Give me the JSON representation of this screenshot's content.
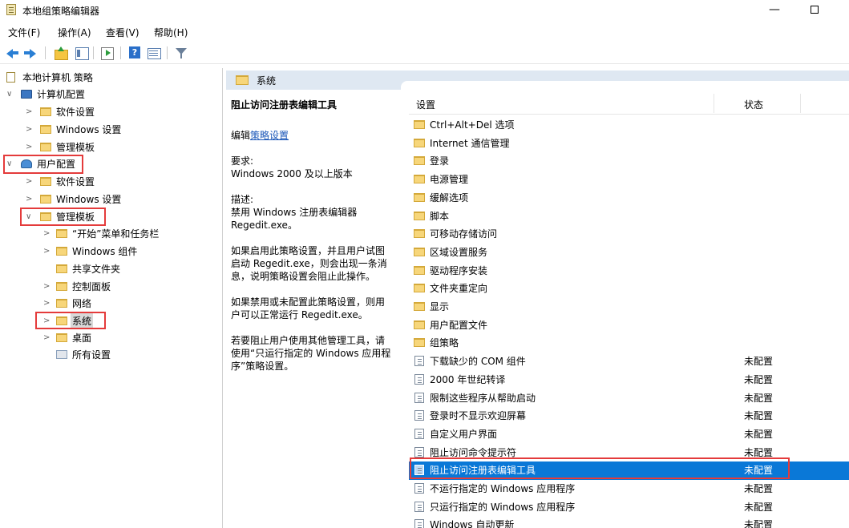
{
  "window": {
    "title": "本地组策略编辑器",
    "minimize_glyph": "—"
  },
  "menu": [
    {
      "label": "文件(F)"
    },
    {
      "label": "操作(A)"
    },
    {
      "label": "查看(V)"
    },
    {
      "label": "帮助(H)"
    }
  ],
  "toolbar": {
    "icons": [
      "back-arrow-icon",
      "forward-arrow-icon",
      "folder-up-icon",
      "show-hide-tree-icon",
      "export-list-icon",
      "help-icon",
      "details-view-icon",
      "filter-icon"
    ]
  },
  "tree": {
    "items": [
      {
        "label": "本地计算机 策略",
        "chevron": "",
        "icon": "policy-doc-icon"
      },
      {
        "label": "计算机配置",
        "chevron": "∨",
        "icon": "computer-icon"
      },
      {
        "label": "软件设置",
        "chevron": ">",
        "icon": "folder-icon"
      },
      {
        "label": "Windows 设置",
        "chevron": ">",
        "icon": "folder-icon"
      },
      {
        "label": "管理模板",
        "chevron": ">",
        "icon": "folder-icon"
      },
      {
        "label": "用户配置",
        "chevron": "∨",
        "icon": "users-icon"
      },
      {
        "label": "软件设置",
        "chevron": ">",
        "icon": "folder-icon"
      },
      {
        "label": "Windows 设置",
        "chevron": ">",
        "icon": "folder-icon"
      },
      {
        "label": "管理模板",
        "chevron": "∨",
        "icon": "folder-icon"
      },
      {
        "label": "“开始”菜单和任务栏",
        "chevron": ">",
        "icon": "folder-icon"
      },
      {
        "label": "Windows 组件",
        "chevron": ">",
        "icon": "folder-icon"
      },
      {
        "label": "共享文件夹",
        "chevron": "",
        "icon": "folder-icon"
      },
      {
        "label": "控制面板",
        "chevron": ">",
        "icon": "folder-icon"
      },
      {
        "label": "网络",
        "chevron": ">",
        "icon": "folder-icon"
      },
      {
        "label": "系统",
        "chevron": ">",
        "icon": "folder-icon",
        "selected": true
      },
      {
        "label": "桌面",
        "chevron": ">",
        "icon": "folder-icon"
      },
      {
        "label": "所有设置",
        "chevron": "",
        "icon": "all-settings-icon"
      }
    ]
  },
  "content": {
    "header_title": "系统",
    "description": {
      "title": "阻止访问注册表编辑工具",
      "edit_prefix": "编辑",
      "edit_link": "策略设置",
      "requirements_label": "要求:",
      "requirements_value": "Windows 2000 及以上版本",
      "desc_label": "描述:",
      "desc_line1": "禁用 Windows 注册表编辑器",
      "desc_line2": "Regedit.exe。",
      "para1_line1": "如果启用此策略设置，并且用户试图",
      "para1_line2": "启动 Regedit.exe，则会出现一条消",
      "para1_line3": "息，说明策略设置会阻止此操作。",
      "para2_line1": "如果禁用或未配置此策略设置，则用",
      "para2_line2": "户可以正常运行 Regedit.exe。",
      "para3_line1": "若要阻止用户使用其他管理工具，请",
      "para3_line2": "使用“只运行指定的 Windows 应用程",
      "para3_line3": "序”策略设置。"
    },
    "columns": {
      "setting": "设置",
      "state": "状态"
    },
    "rows": [
      {
        "label": "Ctrl+Alt+Del 选项",
        "type": "folder",
        "state": ""
      },
      {
        "label": "Internet 通信管理",
        "type": "folder",
        "state": ""
      },
      {
        "label": "登录",
        "type": "folder",
        "state": ""
      },
      {
        "label": "电源管理",
        "type": "folder",
        "state": ""
      },
      {
        "label": "缓解选项",
        "type": "folder",
        "state": ""
      },
      {
        "label": "脚本",
        "type": "folder",
        "state": ""
      },
      {
        "label": "可移动存储访问",
        "type": "folder",
        "state": ""
      },
      {
        "label": "区域设置服务",
        "type": "folder",
        "state": ""
      },
      {
        "label": "驱动程序安装",
        "type": "folder",
        "state": ""
      },
      {
        "label": "文件夹重定向",
        "type": "folder",
        "state": ""
      },
      {
        "label": "显示",
        "type": "folder",
        "state": ""
      },
      {
        "label": "用户配置文件",
        "type": "folder",
        "state": ""
      },
      {
        "label": "组策略",
        "type": "folder",
        "state": ""
      },
      {
        "label": "下载缺少的 COM 组件",
        "type": "policy",
        "state": "未配置"
      },
      {
        "label": "2000 年世纪转译",
        "type": "policy",
        "state": "未配置"
      },
      {
        "label": "限制这些程序从帮助启动",
        "type": "policy",
        "state": "未配置"
      },
      {
        "label": "登录时不显示欢迎屏幕",
        "type": "policy",
        "state": "未配置"
      },
      {
        "label": "自定义用户界面",
        "type": "policy",
        "state": "未配置"
      },
      {
        "label": "阻止访问命令提示符",
        "type": "policy",
        "state": "未配置"
      },
      {
        "label": "阻止访问注册表编辑工具",
        "type": "policy",
        "state": "未配置",
        "selected": true
      },
      {
        "label": "不运行指定的 Windows 应用程序",
        "type": "policy",
        "state": "未配置"
      },
      {
        "label": "只运行指定的 Windows 应用程序",
        "type": "policy",
        "state": "未配置"
      },
      {
        "label": "Windows 自动更新",
        "type": "policy",
        "state": "未配置"
      }
    ]
  }
}
